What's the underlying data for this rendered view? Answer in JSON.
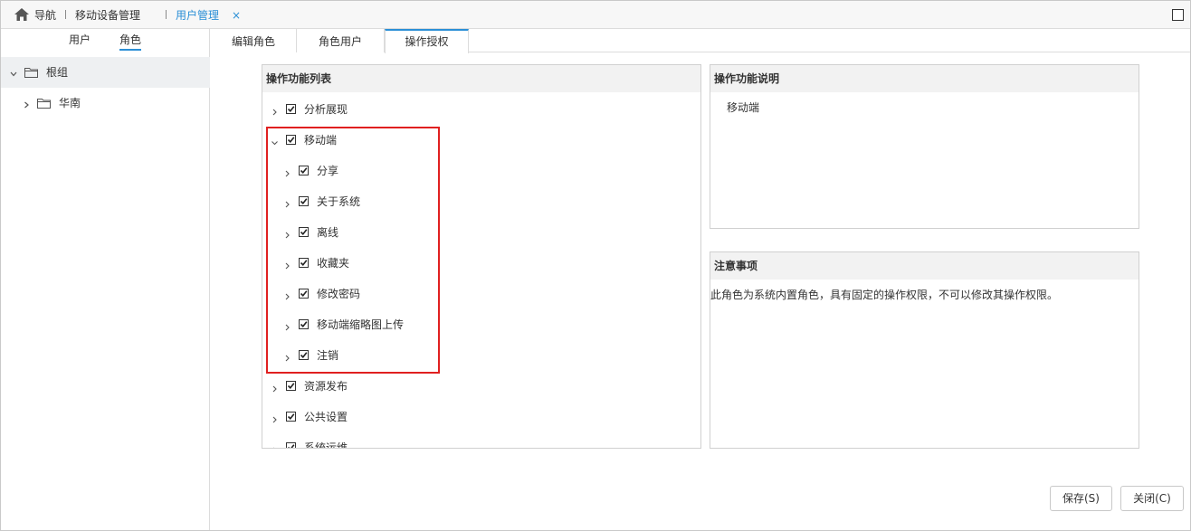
{
  "topbar": {
    "home_label": "导航",
    "crumb_device": "移动设备管理",
    "active_tab": "用户管理",
    "close_symbol": "×"
  },
  "left": {
    "tabs": [
      "用户",
      "角色"
    ],
    "active_tab": "角色",
    "tree": [
      {
        "label": "根组",
        "expanded": true,
        "selected": true
      },
      {
        "label": "华南",
        "expanded": false,
        "selected": false
      }
    ]
  },
  "main_tabs": {
    "items": [
      "编辑角色",
      "角色用户",
      "操作授权"
    ],
    "active": "操作授权"
  },
  "func_list": {
    "title": "操作功能列表",
    "items": [
      {
        "label": "分析展现",
        "checked": true,
        "level": 0,
        "expanded": false
      },
      {
        "label": "移动端",
        "checked": true,
        "level": 0,
        "expanded": true
      },
      {
        "label": "分享",
        "checked": true,
        "level": 1,
        "expanded": false
      },
      {
        "label": "关于系统",
        "checked": true,
        "level": 1,
        "expanded": false
      },
      {
        "label": "离线",
        "checked": true,
        "level": 1,
        "expanded": false
      },
      {
        "label": "收藏夹",
        "checked": true,
        "level": 1,
        "expanded": false
      },
      {
        "label": "修改密码",
        "checked": true,
        "level": 1,
        "expanded": false
      },
      {
        "label": "移动端缩略图上传",
        "checked": true,
        "level": 1,
        "expanded": false
      },
      {
        "label": "注销",
        "checked": true,
        "level": 1,
        "expanded": false
      },
      {
        "label": "资源发布",
        "checked": true,
        "level": 0,
        "expanded": false
      },
      {
        "label": "公共设置",
        "checked": true,
        "level": 0,
        "expanded": false
      },
      {
        "label": "系统运维",
        "checked": true,
        "level": 0,
        "expanded": false
      }
    ]
  },
  "func_desc": {
    "title": "操作功能说明",
    "text": "移动端"
  },
  "notes": {
    "title": "注意事项",
    "text": "此角色为系统内置角色，具有固定的操作权限，不可以修改其操作权限。"
  },
  "buttons": {
    "save": "保存(S)",
    "close": "关闭(C)"
  },
  "colors": {
    "accent": "#2b8fd6",
    "highlight": "#e02020"
  },
  "icons": [
    "home-icon",
    "folder-icon",
    "chevron-icon",
    "checkbox-icon",
    "close-icon",
    "maximize-icon"
  ]
}
